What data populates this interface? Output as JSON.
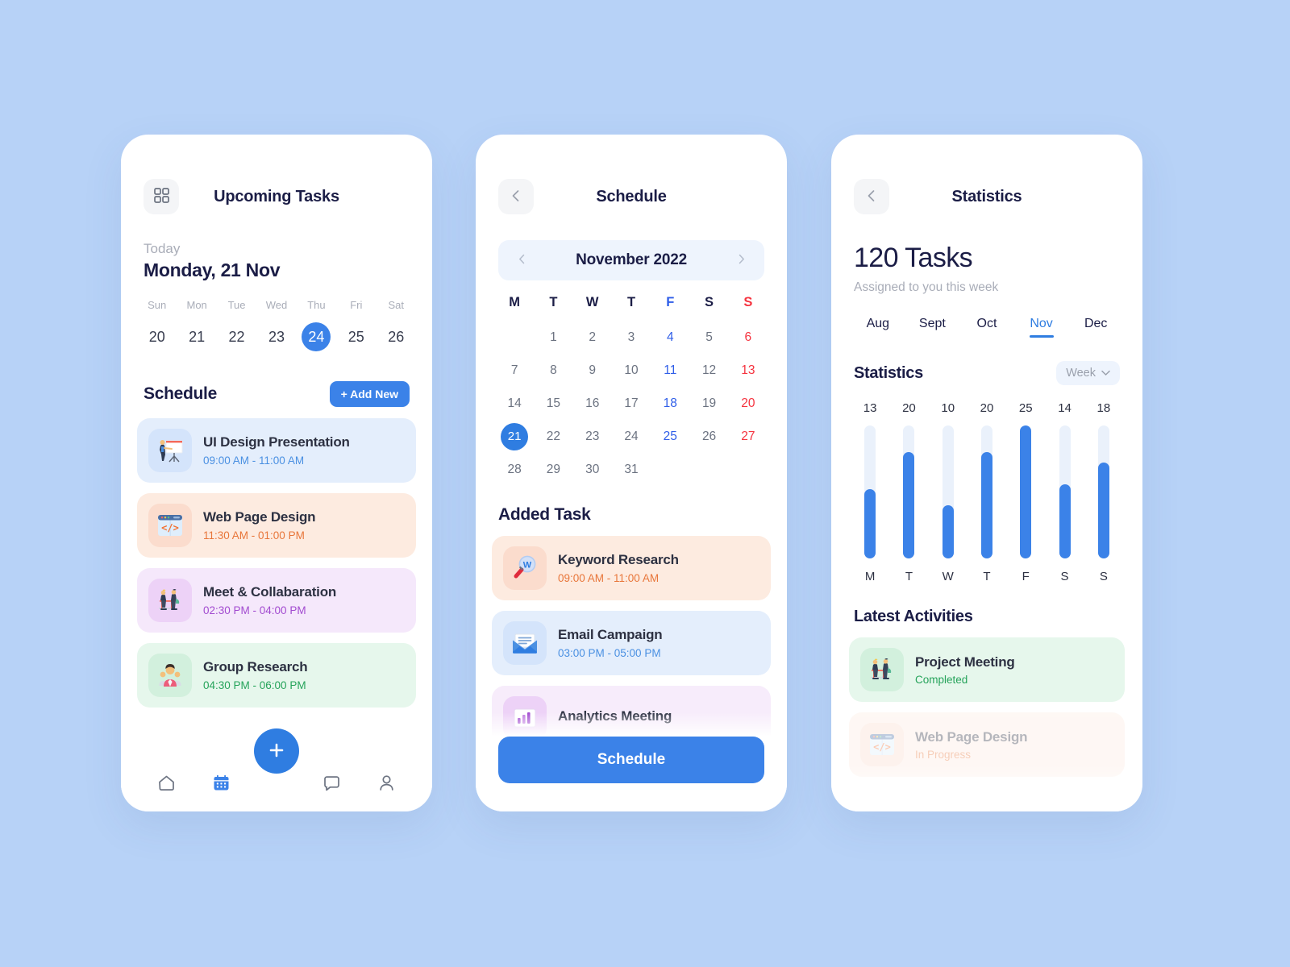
{
  "theme": {
    "page_bg": "#b7d2f7",
    "accent": "#3b82e8",
    "accent_dark": "#2f7de1",
    "heading": "#1b1d46",
    "muted": "#a9adb8",
    "red": "#f5333f"
  },
  "screen1": {
    "header": {
      "title": "Upcoming Tasks",
      "menu_icon": "grid-icon"
    },
    "today_label": "Today",
    "today_date": "Monday, 21 Nov",
    "week": [
      {
        "dow": "Sun",
        "num": "20",
        "selected": false
      },
      {
        "dow": "Mon",
        "num": "21",
        "selected": false
      },
      {
        "dow": "Tue",
        "num": "22",
        "selected": false
      },
      {
        "dow": "Wed",
        "num": "23",
        "selected": false
      },
      {
        "dow": "Thu",
        "num": "24",
        "selected": true
      },
      {
        "dow": "Fri",
        "num": "25",
        "selected": false
      },
      {
        "dow": "Sat",
        "num": "26",
        "selected": false
      }
    ],
    "schedule_title": "Schedule",
    "add_new_label": "+ Add New",
    "tasks": [
      {
        "name": "UI Design Presentation",
        "time": "09:00 AM - 11:00 AM",
        "card_bg": "#e4eefc",
        "icon_bg": "#d4e4fb",
        "time_color": "#4a90e2",
        "icon": "presentation-icon"
      },
      {
        "name": "Web Page Design",
        "time": "11:30 AM - 01:00 PM",
        "card_bg": "#fdebe0",
        "icon_bg": "#fbdccd",
        "time_color": "#e8763a",
        "icon": "code-window-icon"
      },
      {
        "name": "Meet & Collabaration",
        "time": "02:30 PM - 04:00 PM",
        "card_bg": "#f5e8fb",
        "icon_bg": "#edd2f7",
        "time_color": "#a24bd0",
        "icon": "meeting-icon"
      },
      {
        "name": "Group Research",
        "time": "04:30 PM - 06:00 PM",
        "card_bg": "#e6f7ec",
        "icon_bg": "#d2f0dd",
        "time_color": "#25a35a",
        "icon": "group-icon"
      }
    ],
    "fab_label": "+",
    "nav": [
      {
        "name": "home",
        "active": false
      },
      {
        "name": "calendar",
        "active": true
      },
      {
        "name": "chat",
        "active": false
      },
      {
        "name": "profile",
        "active": false
      }
    ]
  },
  "screen2": {
    "header": {
      "title": "Schedule",
      "back_icon": "chevron-left-icon"
    },
    "month": "November 2022",
    "weekday_headers": [
      {
        "label": "M",
        "style": ""
      },
      {
        "label": "T",
        "style": ""
      },
      {
        "label": "W",
        "style": ""
      },
      {
        "label": "T",
        "style": ""
      },
      {
        "label": "F",
        "style": "blue"
      },
      {
        "label": "S",
        "style": ""
      },
      {
        "label": "S",
        "style": "red"
      }
    ],
    "days": [
      {
        "label": "",
        "style": ""
      },
      {
        "label": "1",
        "style": ""
      },
      {
        "label": "2",
        "style": ""
      },
      {
        "label": "3",
        "style": ""
      },
      {
        "label": "4",
        "style": "blue"
      },
      {
        "label": "5",
        "style": ""
      },
      {
        "label": "6",
        "style": "red"
      },
      {
        "label": "7",
        "style": ""
      },
      {
        "label": "8",
        "style": ""
      },
      {
        "label": "9",
        "style": ""
      },
      {
        "label": "10",
        "style": ""
      },
      {
        "label": "11",
        "style": "blue"
      },
      {
        "label": "12",
        "style": ""
      },
      {
        "label": "13",
        "style": "red"
      },
      {
        "label": "14",
        "style": ""
      },
      {
        "label": "15",
        "style": ""
      },
      {
        "label": "16",
        "style": ""
      },
      {
        "label": "17",
        "style": ""
      },
      {
        "label": "18",
        "style": "blue"
      },
      {
        "label": "19",
        "style": ""
      },
      {
        "label": "20",
        "style": "red"
      },
      {
        "label": "21",
        "style": "sel"
      },
      {
        "label": "22",
        "style": ""
      },
      {
        "label": "23",
        "style": ""
      },
      {
        "label": "24",
        "style": ""
      },
      {
        "label": "25",
        "style": "blue"
      },
      {
        "label": "26",
        "style": ""
      },
      {
        "label": "27",
        "style": "red"
      },
      {
        "label": "28",
        "style": ""
      },
      {
        "label": "29",
        "style": ""
      },
      {
        "label": "30",
        "style": ""
      },
      {
        "label": "31",
        "style": ""
      },
      {
        "label": "",
        "style": ""
      },
      {
        "label": "",
        "style": ""
      },
      {
        "label": "",
        "style": ""
      }
    ],
    "added_task_title": "Added Task",
    "tasks": [
      {
        "name": "Keyword Research",
        "time": "09:00 AM - 11:00 AM",
        "card_bg": "#fdebe0",
        "icon_bg": "#fbdccd",
        "time_color": "#e8763a",
        "icon": "magnifier-w-icon"
      },
      {
        "name": "Email Campaign",
        "time": "03:00 PM - 05:00 PM",
        "card_bg": "#e4eefc",
        "icon_bg": "#d4e4fb",
        "time_color": "#4a90e2",
        "icon": "envelope-icon"
      },
      {
        "name": "Analytics Meeting",
        "time": "",
        "card_bg": "#f7ecfb",
        "icon_bg": "#edd2f7",
        "time_color": "#a24bd0",
        "icon": "analytics-icon"
      }
    ],
    "schedule_button_label": "Schedule"
  },
  "screen3": {
    "header": {
      "title": "Statistics",
      "back_icon": "chevron-left-icon"
    },
    "task_count": "120 Tasks",
    "subtitle": "Assigned to you this week",
    "month_tabs": [
      {
        "label": "Aug",
        "active": false
      },
      {
        "label": "Sept",
        "active": false
      },
      {
        "label": "Oct",
        "active": false
      },
      {
        "label": "Nov",
        "active": true
      },
      {
        "label": "Dec",
        "active": false
      }
    ],
    "stats_title": "Statistics",
    "range_selector": {
      "label": "Week",
      "icon": "chevron-down-icon"
    },
    "activities_title": "Latest Activities",
    "activities": [
      {
        "name": "Project Meeting",
        "status": "Completed",
        "card_bg": "#e6f7ec",
        "icon_bg": "#d2f0dd",
        "status_color": "#25a35a",
        "icon": "meeting-icon",
        "dim": false
      },
      {
        "name": "Web Page Design",
        "status": "In Progress",
        "card_bg": "#fdebe0",
        "icon_bg": "#fbdccd",
        "status_color": "#e8763a",
        "icon": "code-window-icon",
        "dim": true
      }
    ]
  },
  "chart_data": {
    "type": "bar",
    "title": "Statistics",
    "categories": [
      "M",
      "T",
      "W",
      "T",
      "F",
      "S",
      "S"
    ],
    "values": [
      13,
      20,
      10,
      20,
      25,
      14,
      18
    ],
    "value_labels": [
      "13",
      "20",
      "10",
      "20",
      "25",
      "14",
      "18"
    ],
    "ylim": [
      0,
      25
    ],
    "xlabel": "",
    "ylabel": "",
    "grid": false,
    "legend": "none",
    "bar_color": "#3b82e8",
    "track_color": "#eaf1fb",
    "data_labels_position": "above"
  }
}
